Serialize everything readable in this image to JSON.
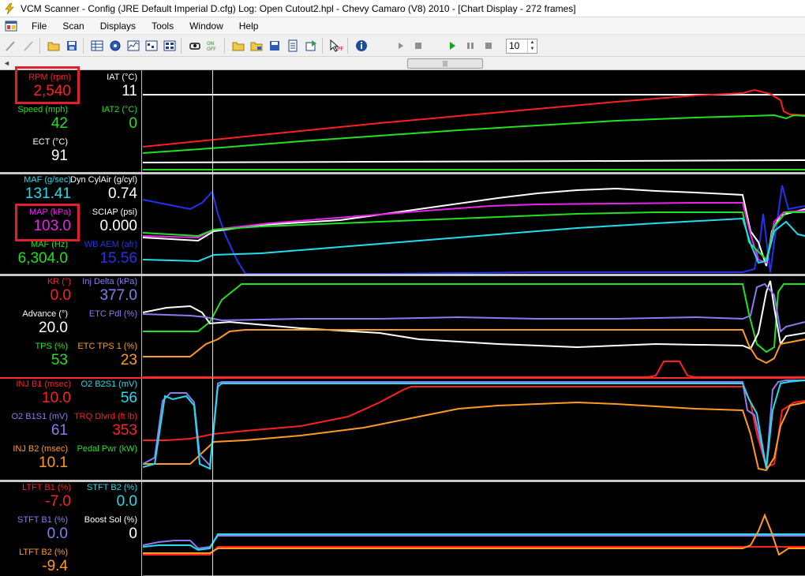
{
  "window": {
    "title": "VCM Scanner  -  Config  (JRE Default Imperial D.cfg)    Log:  Open Cutout2.hpl    -   Chevy Camaro (V8) 2010  -  [Chart Display  -  272 frames]"
  },
  "menu": {
    "items": [
      "File",
      "Scan",
      "Displays",
      "Tools",
      "Window",
      "Help"
    ]
  },
  "toolbar": {
    "frame_step_value": "10"
  },
  "colors": {
    "red": "#ff2020",
    "green": "#22e022",
    "white": "#ffffff",
    "cyan": "#22ddee",
    "magenta": "#ee22ee",
    "blue": "#2233ee",
    "purple": "#8a7cf0",
    "orange": "#ff9a22"
  },
  "panels": [
    {
      "params": [
        {
          "label": "RPM (rpm)",
          "value": "2,540",
          "color": "#ff2020"
        },
        {
          "label": "IAT (°C)",
          "value": "11",
          "color": "#ffffff"
        },
        {
          "label": "Speed (mph)",
          "value": "42",
          "color": "#22e022"
        },
        {
          "label": "IAT2 (°C)",
          "value": "0",
          "color": "#22e022"
        },
        {
          "label": "ECT (°C)",
          "value": "91",
          "color": "#ffffff"
        }
      ]
    },
    {
      "params": [
        {
          "label": "MAF (g/sec)",
          "value": "131.41",
          "color": "#22ddee"
        },
        {
          "label": "Dyn CylAir (g/cyl)",
          "value": "0.74",
          "color": "#ffffff"
        },
        {
          "label": "MAP (kPa)",
          "value": "103.0",
          "color": "#ee22ee"
        },
        {
          "label": "SCIAP (psi)",
          "value": "0.000",
          "color": "#ffffff"
        },
        {
          "label": "MAF (Hz)",
          "value": "6,304.0",
          "color": "#22e022"
        },
        {
          "label": "WB AEM (afr)",
          "value": "15.56",
          "color": "#2233ee"
        }
      ]
    },
    {
      "params": [
        {
          "label": "KR (°)",
          "value": "0.0",
          "color": "#ff2020"
        },
        {
          "label": "Inj Delta (kPa)",
          "value": "377.0",
          "color": "#8a7cf0"
        },
        {
          "label": "Advance (°)",
          "value": "20.0",
          "color": "#ffffff"
        },
        {
          "label": "ETC Pdl (%)",
          "value": "",
          "color": "#8a7cf0"
        },
        {
          "label": "TPS (%)",
          "value": "53",
          "color": "#22e022"
        },
        {
          "label": "ETC TPS 1 (%)",
          "value": "23",
          "color": "#ff9a22"
        }
      ]
    },
    {
      "params": [
        {
          "label": "INJ B1 (msec)",
          "value": "10.0",
          "color": "#ff2020"
        },
        {
          "label": "O2 B2S1 (mV)",
          "value": "56",
          "color": "#22ddee"
        },
        {
          "label": "O2 B1S1 (mV)",
          "value": "61",
          "color": "#8a7cf0"
        },
        {
          "label": "TRQ Dlvrd (ft lb)",
          "value": "353",
          "color": "#ff2020"
        },
        {
          "label": "INJ B2 (msec)",
          "value": "10.1",
          "color": "#ff9a22"
        },
        {
          "label": "Pedal Pwr (kW)",
          "value": "",
          "color": "#22e022"
        }
      ]
    },
    {
      "params": [
        {
          "label": "LTFT B1 (%)",
          "value": "-7.0",
          "color": "#ff2020"
        },
        {
          "label": "STFT B2 (%)",
          "value": "0.0",
          "color": "#22ddee"
        },
        {
          "label": "STFT B1 (%)",
          "value": "0.0",
          "color": "#8a7cf0"
        },
        {
          "label": "Boost Sol (%)",
          "value": "0",
          "color": "#ffffff"
        },
        {
          "label": "LTFT B2 (%)",
          "value": "-9.4",
          "color": "#ff9a22"
        }
      ]
    }
  ]
}
